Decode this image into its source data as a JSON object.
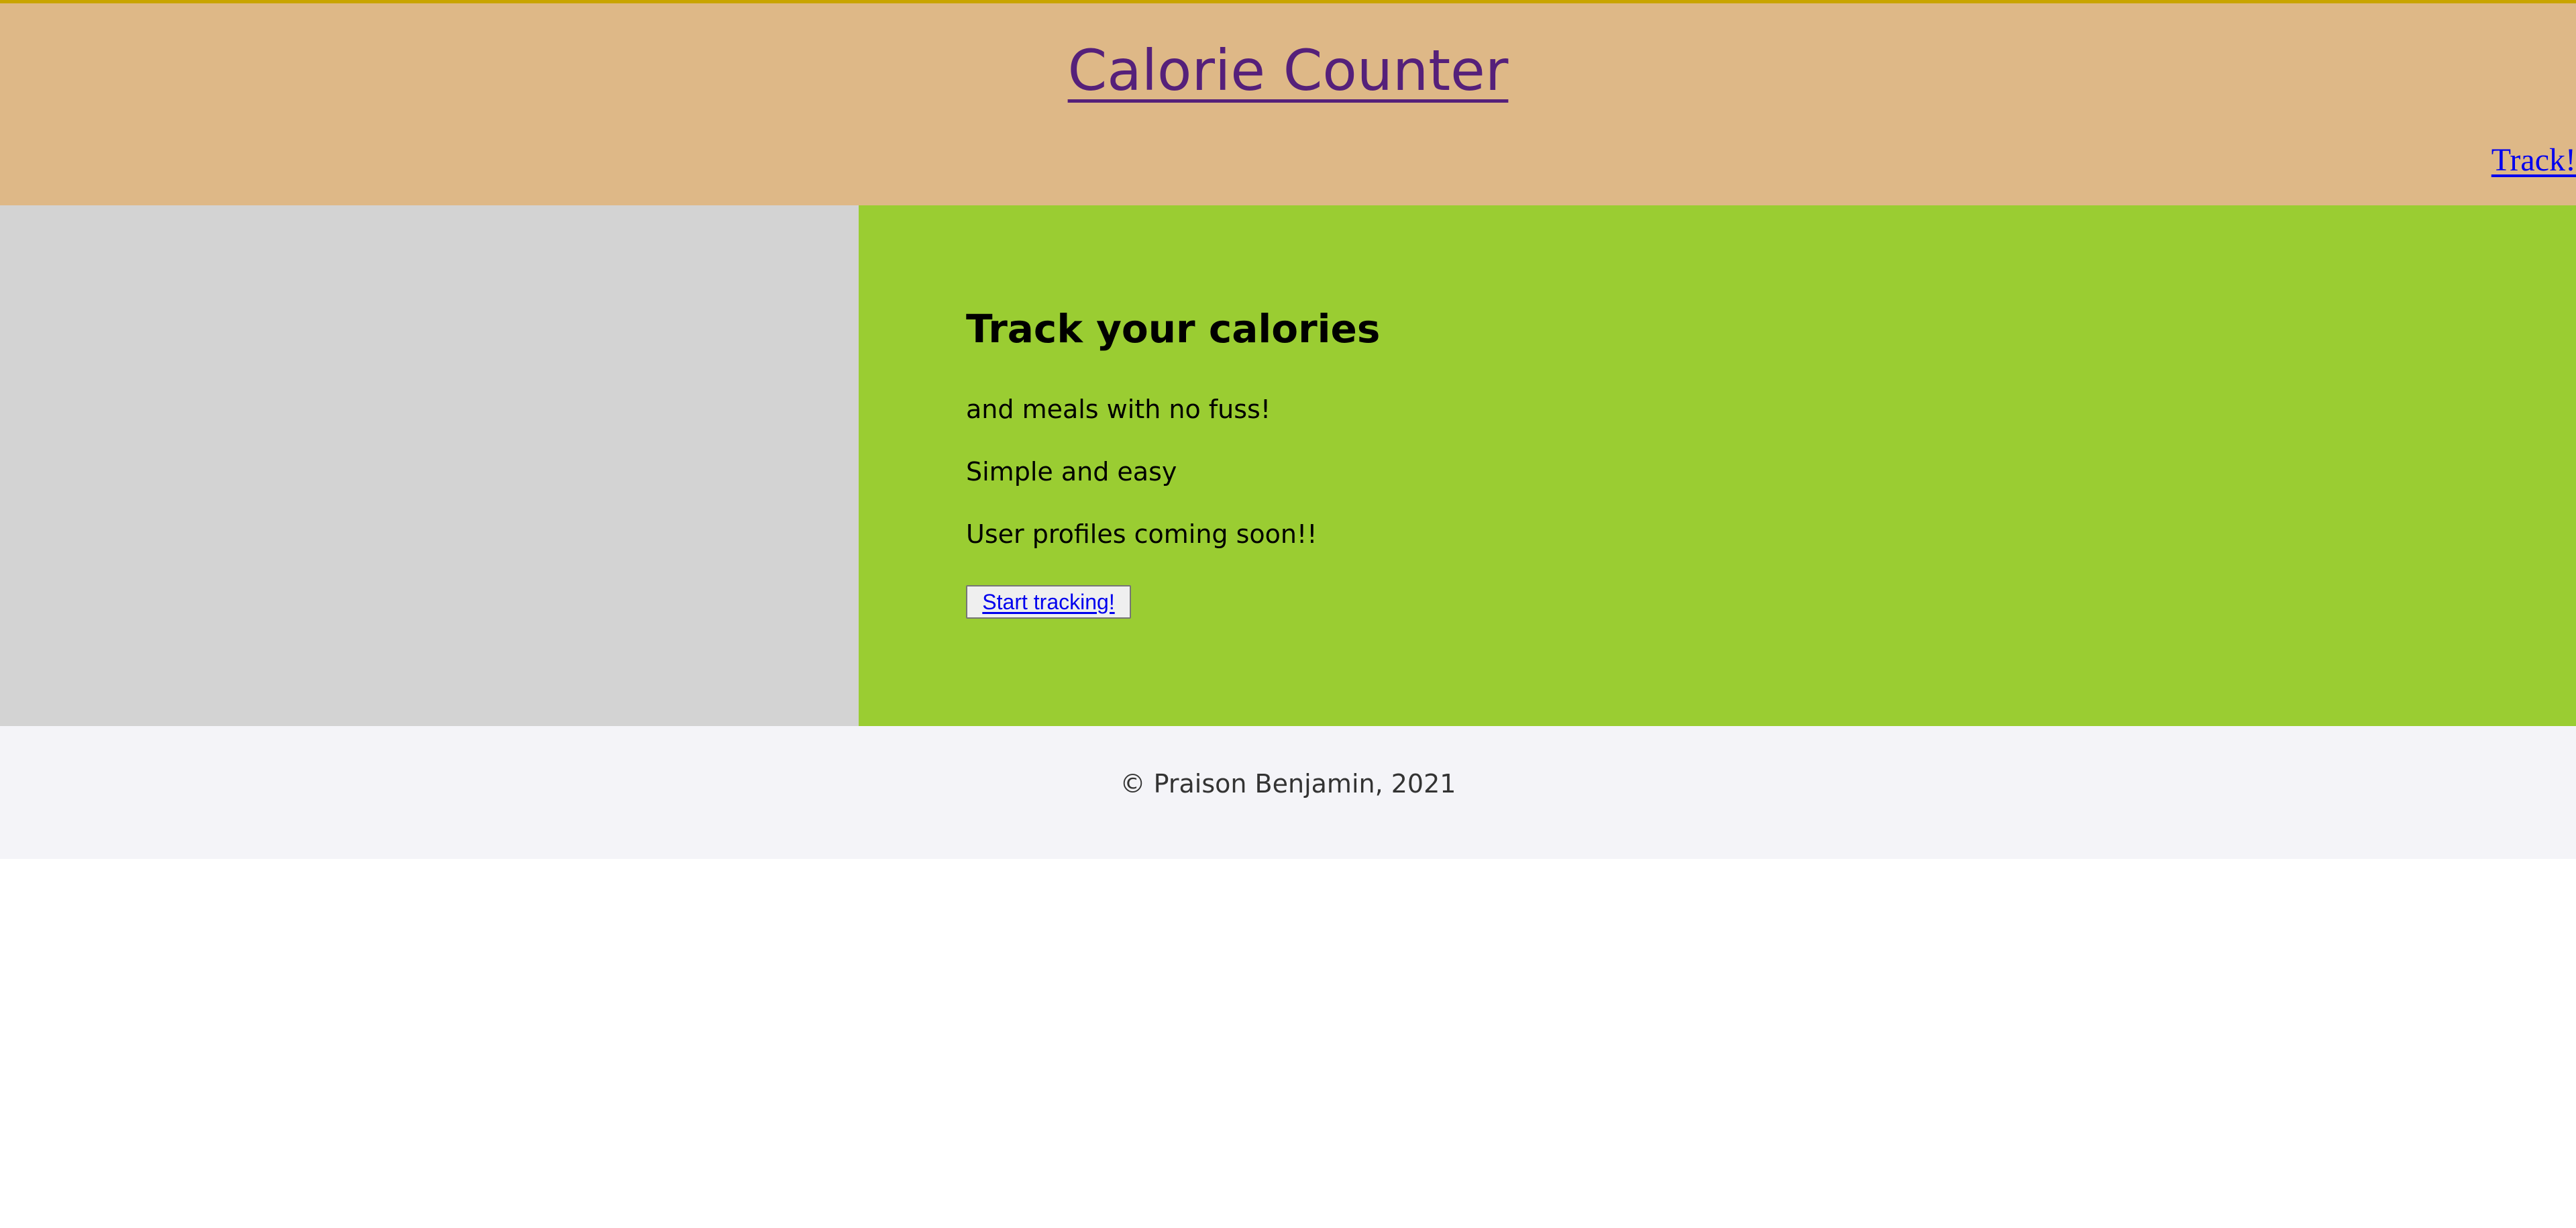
{
  "header": {
    "site_title": "Calorie Counter",
    "nav_link": "Track!"
  },
  "hero": {
    "heading": "Track your calories",
    "lines": [
      "and meals with no fuss!",
      "Simple and easy",
      "User profiles coming soon!!"
    ],
    "button_label": "Start tracking!"
  },
  "footer": {
    "copyright": "© Praison Benjamin, 2021"
  },
  "colors": {
    "header_bg": "#deb887",
    "header_top_border": "#c9a400",
    "title_link": "#55207a",
    "link_blue": "#0000ee",
    "hero_left_bg": "#d3d3d3",
    "hero_right_bg": "#9acd32",
    "footer_bg": "#f4f4f8"
  }
}
